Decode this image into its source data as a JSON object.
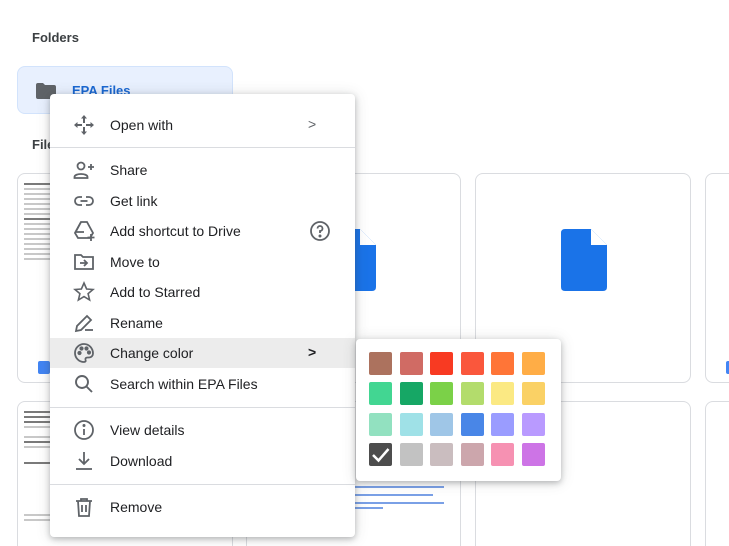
{
  "sections": {
    "folders_label": "Folders",
    "files_label": "File"
  },
  "folder": {
    "name": "EPA Files",
    "icon": "folder-icon"
  },
  "menu": {
    "open_with": "Open with",
    "share": "Share",
    "get_link": "Get link",
    "add_shortcut": "Add shortcut to Drive",
    "move_to": "Move to",
    "add_starred": "Add to Starred",
    "rename": "Rename",
    "change_color": "Change color",
    "search_within": "Search within EPA Files",
    "view_details": "View details",
    "download": "Download",
    "remove": "Remove",
    "submenu_arrow": ">"
  },
  "color_picker": {
    "selected": "#4d4d4d",
    "colors": [
      [
        "#ac725e",
        "#d06b64",
        "#f83a22",
        "#fa573c",
        "#ff7537",
        "#ffad46"
      ],
      [
        "#42d692",
        "#16a765",
        "#7bd148",
        "#b3dc6c",
        "#fbe983",
        "#fad165"
      ],
      [
        "#92e1c0",
        "#9fe1e7",
        "#9fc6e7",
        "#4986e7",
        "#9a9cff",
        "#b99aff"
      ],
      [
        "#4d4d4d",
        "#c2c2c2",
        "#cabdbf",
        "#cca6ac",
        "#f691b2",
        "#cd74e6"
      ]
    ]
  },
  "colors": {
    "accent": "#1a73e8",
    "folder_text": "#1967d2",
    "menu_highlight": "#ececec"
  }
}
